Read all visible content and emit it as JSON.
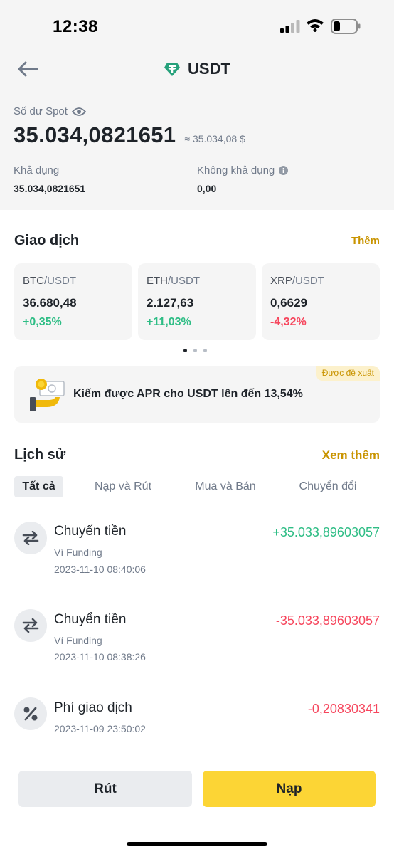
{
  "status_bar": {
    "time": "12:38"
  },
  "header": {
    "title": "USDT"
  },
  "balance": {
    "spot_label": "Số dư Spot",
    "amount": "35.034,0821651",
    "fiat": "≈ 35.034,08 $",
    "available_label": "Khả dụng",
    "available_value": "35.034,0821651",
    "unavailable_label": "Không khả dụng",
    "unavailable_value": "0,00"
  },
  "trade": {
    "title": "Giao dịch",
    "more": "Thêm",
    "pairs": [
      {
        "base": "BTC",
        "quote": "/USDT",
        "price": "36.680,48",
        "change": "+0,35%"
      },
      {
        "base": "ETH",
        "quote": "/USDT",
        "price": "2.127,63",
        "change": "+11,03%"
      },
      {
        "base": "XRP",
        "quote": "/USDT",
        "price": "0,6629",
        "change": "-4,32%"
      }
    ]
  },
  "promo": {
    "badge": "Được đề xuất",
    "text": "Kiếm được APR cho USDT lên đến 13,54%"
  },
  "history": {
    "title": "Lịch sử",
    "more": "Xem thêm",
    "tabs": [
      "Tất cả",
      "Nạp và Rút",
      "Mua và Bán",
      "Chuyển đổi"
    ],
    "items": [
      {
        "icon": "transfer-icon",
        "title": "Chuyển tiền",
        "subtitle": "Ví Funding",
        "time": "2023-11-10 08:40:06",
        "amount": "+35.033,89603057"
      },
      {
        "icon": "transfer-icon",
        "title": "Chuyển tiền",
        "subtitle": "Ví Funding",
        "time": "2023-11-10 08:38:26",
        "amount": "-35.033,89603057"
      },
      {
        "icon": "percent-icon",
        "title": "Phí giao dịch",
        "time": "2023-11-09 23:50:02",
        "amount": "-0,20830341"
      }
    ]
  },
  "actions": {
    "withdraw": "Rút",
    "deposit": "Nạp"
  },
  "colors": {
    "accent": "#c99400",
    "primary_button": "#fcd535",
    "positive": "#2ebd85",
    "negative": "#f6465d",
    "usdt_green": "#26a17b"
  }
}
